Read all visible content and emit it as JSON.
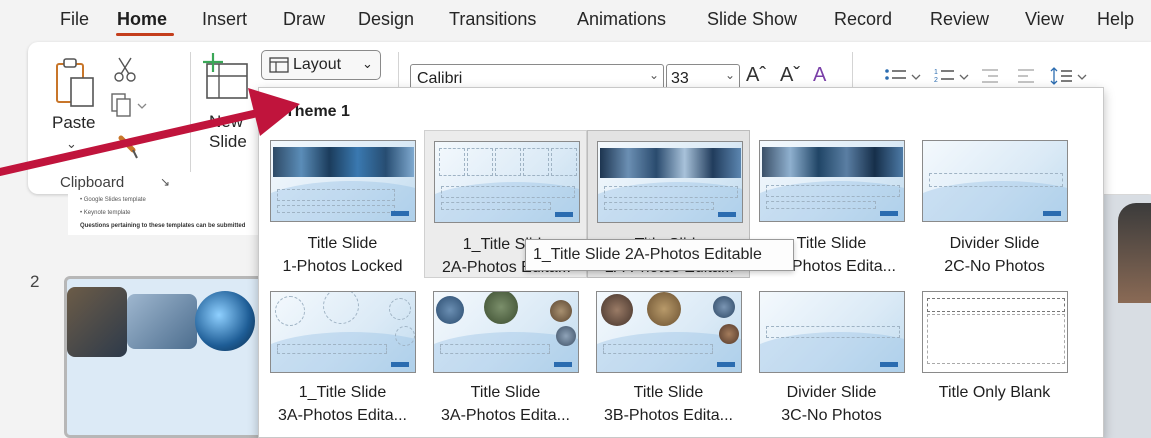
{
  "menu": {
    "tabs": [
      "File",
      "Home",
      "Insert",
      "Draw",
      "Design",
      "Transitions",
      "Animations",
      "Slide Show",
      "Record",
      "Review",
      "View",
      "Help"
    ],
    "active": "Home"
  },
  "ribbon": {
    "paste_label": "Paste",
    "clipboard_group": "Clipboard",
    "new_slide_label": "New Slide",
    "layout_button": "Layout",
    "font_name": "Calibri",
    "font_size": "33",
    "grow_font": "Aˆ",
    "shrink_font": "Aˇ",
    "clear_format": "A"
  },
  "slides_panel": {
    "partial_thumb_lines": [
      "• Google Slides template",
      "• Keynote template",
      "Questions pertaining to these templates can be submitted"
    ],
    "slide_number": "2"
  },
  "layout_gallery": {
    "section_title": "Theme 1",
    "items": [
      {
        "line1": "Title Slide",
        "line2": "1-Photos Locked"
      },
      {
        "line1": "1_Title Slide",
        "line2": "2A-Photos Edita..."
      },
      {
        "line1": "Title Slide",
        "line2": "2A-Photos Edita..."
      },
      {
        "line1": "Title Slide",
        "line2": "2B-Photos Edita..."
      },
      {
        "line1": "Divider Slide",
        "line2": "2C-No Photos"
      },
      {
        "line1": "1_Title Slide",
        "line2": "3A-Photos Edita..."
      },
      {
        "line1": "Title Slide",
        "line2": "3A-Photos Edita..."
      },
      {
        "line1": "Title Slide",
        "line2": "3B-Photos Edita..."
      },
      {
        "line1": "Divider Slide",
        "line2": "3C-No Photos"
      },
      {
        "line1": "Title Only Blank",
        "line2": ""
      }
    ],
    "tooltip": "1_Title Slide 2A-Photos Editable"
  },
  "colors": {
    "accent_underline": "#c43e1c",
    "annotation_arrow": "#c0143c",
    "new_slide_icon": "#3aa757"
  }
}
